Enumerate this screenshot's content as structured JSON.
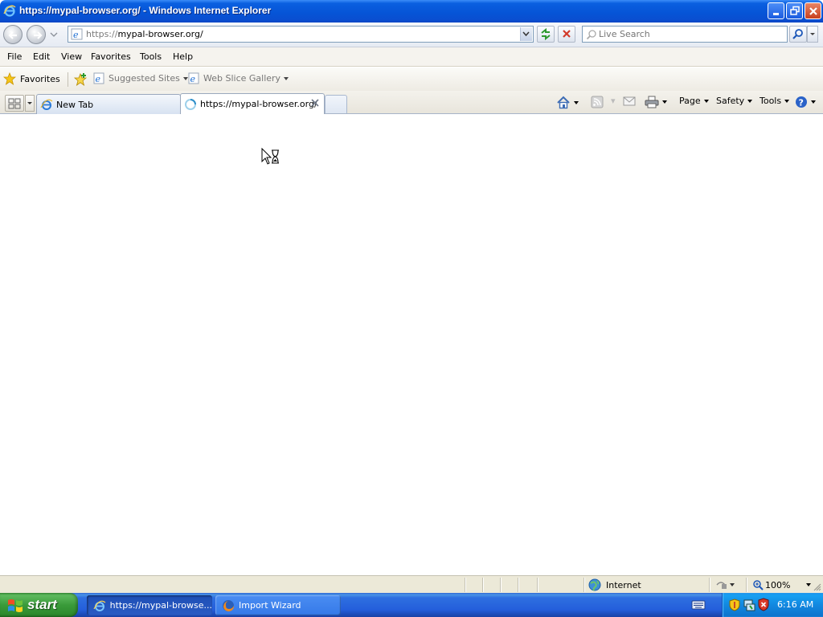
{
  "window": {
    "title": "https://mypal-browser.org/ - Windows Internet Explorer"
  },
  "address_bar": {
    "url_protocol": "https://",
    "url_host": "mypal-browser.org/",
    "search_placeholder": "Live Search"
  },
  "menu": {
    "items": [
      "File",
      "Edit",
      "View",
      "Favorites",
      "Tools",
      "Help"
    ]
  },
  "favorites_bar": {
    "favorites_label": "Favorites",
    "links": [
      "Suggested Sites",
      "Web Slice Gallery"
    ]
  },
  "tabs": [
    {
      "label": "New Tab",
      "active": false
    },
    {
      "label": "https://mypal-browser.org/",
      "active": true
    }
  ],
  "command_bar": {
    "page_label": "Page",
    "safety_label": "Safety",
    "tools_label": "Tools"
  },
  "status_bar": {
    "zone": "Internet",
    "zoom": "100%"
  },
  "taskbar": {
    "start_label": "start",
    "items": [
      {
        "label": "https://mypal-browse...",
        "active": true
      },
      {
        "label": "Import Wizard",
        "active": false
      }
    ],
    "clock": "6:16 AM"
  },
  "colors": {
    "titlebar": "#0654d6",
    "taskbar": "#245edb",
    "start_button": "#3a9b3a"
  }
}
